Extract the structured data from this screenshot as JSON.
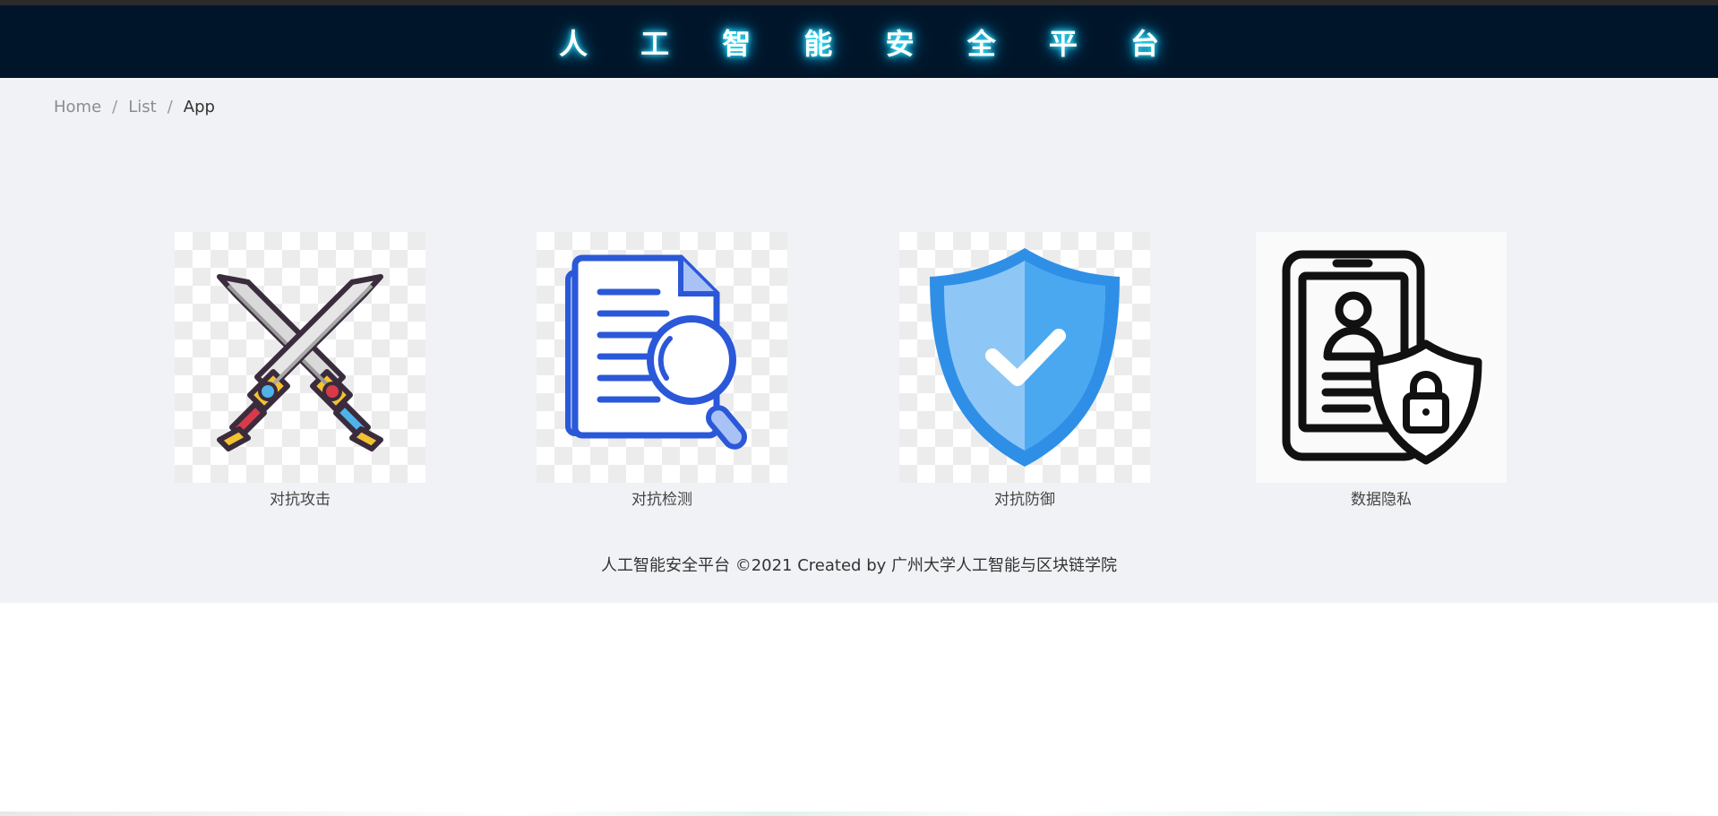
{
  "header": {
    "title": "人 工 智 能 安 全 平 台"
  },
  "breadcrumb": {
    "items": [
      "Home",
      "List",
      "App"
    ],
    "separator": "/"
  },
  "cards": [
    {
      "label": "对抗攻击",
      "icon": "crossed-swords-icon"
    },
    {
      "label": "对抗检测",
      "icon": "document-search-icon"
    },
    {
      "label": "对抗防御",
      "icon": "shield-check-icon"
    },
    {
      "label": "数据隐私",
      "icon": "phone-user-lock-icon"
    }
  ],
  "footer": {
    "text": "人工智能安全平台 ©2021 Created by 广州大学人工智能与区块链学院"
  },
  "colors": {
    "header_bg": "#001529",
    "content_bg": "#f0f2f5",
    "title_glow": "#18c8ff"
  }
}
